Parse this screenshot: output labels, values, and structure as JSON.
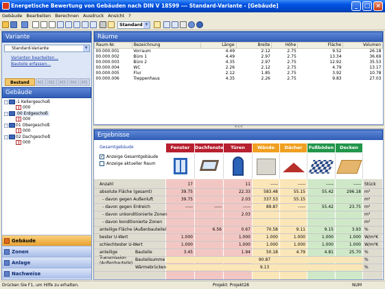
{
  "window": {
    "title": "Energetische Bewertung von Gebäuden nach DIN V 18599 --- Standard-Variante - [Gebäude]",
    "min_label": "_",
    "max_label": "□",
    "close_label": "×"
  },
  "menu": [
    "Gebäude",
    "Bearbeiten",
    "Berechnen",
    "Ausdruck",
    "Ansicht",
    "?"
  ],
  "toolbar": {
    "variant_value": "Standard"
  },
  "variante": {
    "title": "Variante",
    "select_value": "Standard-Variante",
    "link1": "Varianten bearbeiten...",
    "link2": "Bauteile erfassen...",
    "tabs": [
      "Bestand",
      "M1",
      "M2",
      "M3",
      "M4",
      "M5"
    ]
  },
  "gebaeude": {
    "title": "Gebäude",
    "tree": [
      {
        "label": "-1 Kellergeschoß",
        "child": "000"
      },
      {
        "label": "00 Erdgeschoß",
        "child": "000"
      },
      {
        "label": "01 Obergeschoß",
        "child": "000"
      },
      {
        "label": "02 Dachgeschoß",
        "child": "000"
      }
    ]
  },
  "nav": [
    "Gebäude",
    "Zonen",
    "Anlage",
    "Nachweise"
  ],
  "raeume": {
    "title": "Räume",
    "columns": [
      "Raum-Nr.",
      "Bezeichnung",
      "Länge",
      "Breite",
      "Höhe",
      "Fläche",
      "Volumen"
    ],
    "rows": [
      [
        "00.000.001",
        "Vorraum",
        "4.49",
        "2.12",
        "2.75",
        "9.52",
        "26.18"
      ],
      [
        "00.000.002",
        "Büro 1",
        "4.49",
        "2.97",
        "2.75",
        "13.34",
        "36.69"
      ],
      [
        "00.000.003",
        "Büro 2",
        "4.35",
        "2.97",
        "2.75",
        "12.92",
        "35.53"
      ],
      [
        "00.000.004",
        "WC",
        "2.26",
        "2.12",
        "2.75",
        "4.79",
        "13.17"
      ],
      [
        "00.000.005",
        "Flur",
        "2.12",
        "1.85",
        "2.75",
        "3.92",
        "10.78"
      ],
      [
        "00.000.006",
        "Treppenhaus",
        "4.35",
        "2.26",
        "2.75",
        "9.83",
        "27.03"
      ]
    ],
    "collapse_label": "<<<"
  },
  "ergebnisse": {
    "title": "Ergebnisse",
    "gesamt_label": "Gesamtgebäude",
    "check1": "Anzeige Gesamtgebäude",
    "check2": "Anzeige aktueller Raum",
    "columns": [
      {
        "name": "Fenster",
        "color": "#b7202f",
        "bg": "#f2c7c3"
      },
      {
        "name": "Dachfenster",
        "color": "#b7202f",
        "bg": "#f2c7c3"
      },
      {
        "name": "Türen",
        "color": "#b7202f",
        "bg": "#f2c7c3"
      },
      {
        "name": "Wände",
        "color": "#f0a020",
        "bg": "#fbe6b8"
      },
      {
        "name": "Dächer",
        "color": "#f0a020",
        "bg": "#fbe6b8"
      },
      {
        "name": "Fußböden",
        "color": "#22954a",
        "bg": "#cfe9c8"
      },
      {
        "name": "Decken",
        "color": "#22954a",
        "bg": "#cfe9c8"
      }
    ],
    "rows": [
      {
        "label": "Anzahl",
        "vals": [
          "17",
          "",
          "11",
          "-----",
          "-----",
          "-----",
          "-----"
        ],
        "unit": "Stück"
      },
      {
        "label": "absolute Fläche (gesamt)",
        "vals": [
          "39.75",
          "",
          "22.33",
          "583.48",
          "55.15",
          "55.42",
          "296.18"
        ],
        "unit": "m²"
      },
      {
        "label": "- davon gegen Außenluft",
        "vals": [
          "39.75",
          "",
          "2.03",
          "337.53",
          "55.15",
          "",
          ""
        ],
        "unit": "m²"
      },
      {
        "label": "- davon gegen Erdreich",
        "vals": [
          "-----",
          "-----",
          "-----",
          "89.87",
          "-----",
          "55.42",
          "23.75"
        ],
        "unit": "m²"
      },
      {
        "label": "- davon unkonditionierte Zonen",
        "vals": [
          "",
          "",
          "2.03",
          "",
          "",
          "",
          ""
        ],
        "unit": "m²"
      },
      {
        "label": "- davon konditionierte Zonen",
        "vals": [
          "",
          "",
          "",
          "",
          "",
          "",
          ""
        ],
        "unit": "m²"
      },
      {
        "label": "anteilige Fläche (Außenbauteile)",
        "vals": [
          "",
          "6.56",
          "0.67",
          "70.58",
          "9.11",
          "9.15",
          "3.93"
        ],
        "unit": "%"
      },
      {
        "label": "bester U-Wert",
        "vals": [
          "1.000",
          "",
          "1.000",
          "1.000",
          "1.000",
          "1.000",
          "1.000"
        ],
        "unit": "W/m²K"
      },
      {
        "label": "schlechtester U-Wert",
        "vals": [
          "1.000",
          "",
          "1.000",
          "1.000",
          "1.000",
          "1.000",
          "1.000"
        ],
        "unit": "W/m²K"
      }
    ],
    "transmission_label1": "anteilige",
    "transmission_label2": "Transmission",
    "transmission_label3": "(Außenbauteile)",
    "sub_rows": [
      {
        "label": "Bauteile",
        "vals": [
          "3.45",
          "",
          "1.94",
          "50.18",
          "4.79",
          "4.81",
          "25.70"
        ],
        "unit": "%"
      },
      {
        "label": "Bauteilsumme",
        "total": "90.87",
        "unit": "%"
      },
      {
        "label": "Wärmebrücken",
        "total": "9.13",
        "unit": "%"
      }
    ]
  },
  "status": {
    "help": "Drücken Sie F1, um Hilfe zu erhalten.",
    "project": "Projekt: Projekt28",
    "num": "NUM"
  }
}
